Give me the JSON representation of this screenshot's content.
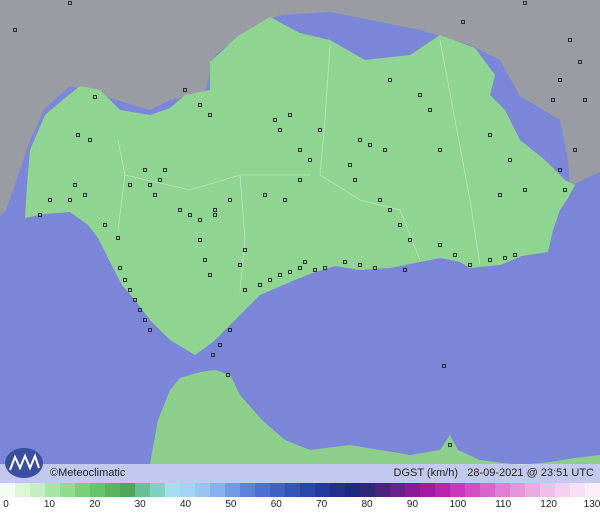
{
  "map": {
    "credit": "©Meteoclimatic",
    "variable": "DGST (km/h)",
    "datetime": "28-09-2021 @ 23:51 UTC",
    "colors": {
      "sea": "#7b86d9",
      "land_other": "#9a9ca3",
      "land_andalusia": "#8fd490",
      "land_africa": "#8ccf8a",
      "station": "#222222"
    }
  },
  "scale": {
    "labels": [
      "0",
      "10",
      "20",
      "30",
      "40",
      "50",
      "60",
      "70",
      "80",
      "90",
      "100",
      "110",
      "120",
      "130"
    ],
    "colors": [
      "#f0fff0",
      "#dcf7d8",
      "#c4efc0",
      "#a8e6a6",
      "#8fdc8f",
      "#78d078",
      "#68c46c",
      "#5ab45e",
      "#50a658",
      "#67bf94",
      "#7fd2c2",
      "#a2def0",
      "#a4d2f6",
      "#9ac3f2",
      "#86b2ec",
      "#6f9ae4",
      "#5a84da",
      "#4c72cf",
      "#3f62c4",
      "#3554b8",
      "#2b46ab",
      "#22399d",
      "#1e318f",
      "#1c2a82",
      "#2f2878",
      "#4a2480",
      "#6a1f8c",
      "#8a1a98",
      "#a21aa4",
      "#b724ae",
      "#c838b8",
      "#d24ec2",
      "#da66ca",
      "#e07ed2",
      "#e694da",
      "#ecaae2",
      "#f0bee8",
      "#f4d0ee",
      "#f8e0f4",
      "#fcedf9"
    ]
  }
}
